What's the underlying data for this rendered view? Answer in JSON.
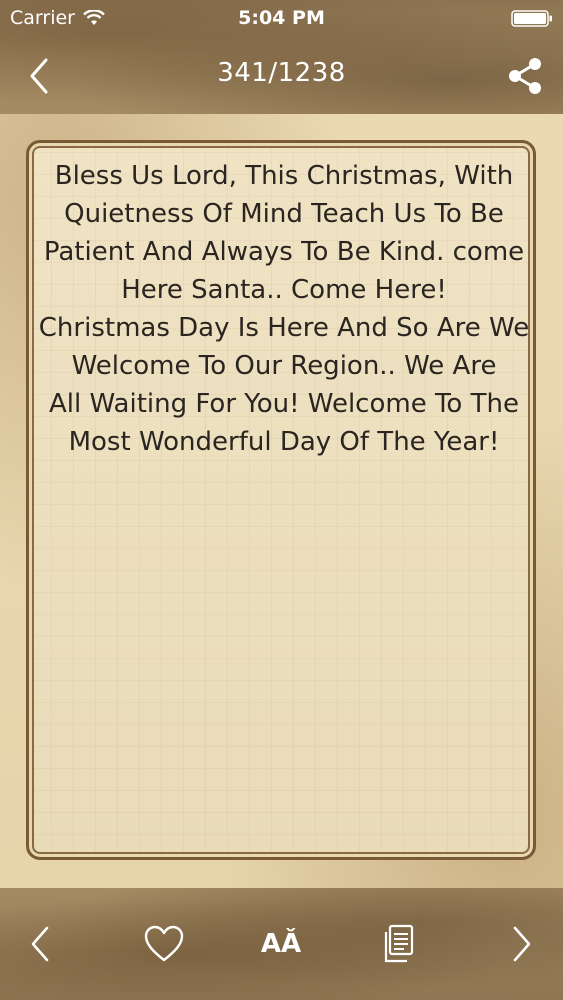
{
  "status_bar": {
    "carrier": "Carrier",
    "time": "5:04 PM",
    "wifi_icon": "wifi-icon",
    "battery_icon": "battery-full-icon"
  },
  "nav": {
    "title": "341/1238",
    "back_icon": "chevron-left-icon",
    "share_icon": "share-icon"
  },
  "quote": {
    "text": "Bless Us Lord, This Christmas, With Quietness Of Mind Teach Us To Be Patient And Always To Be Kind. come Here Santa.. Come Here!\nChristmas Day Is Here And So Are We Welcome To Our Region.. We Are\nAll Waiting For You! Welcome To The\nMost Wonderful Day Of The Year!"
  },
  "toolbar": {
    "prev_icon": "chevron-left-icon",
    "favorite_icon": "heart-outline-icon",
    "font_label": "AǍ",
    "copy_icon": "copy-document-icon",
    "next_icon": "chevron-right-icon"
  },
  "colors": {
    "bar_brown": "#9d845e",
    "paper": "#ead9b2",
    "card_border": "#7a5a34",
    "text": "#2a2520"
  }
}
